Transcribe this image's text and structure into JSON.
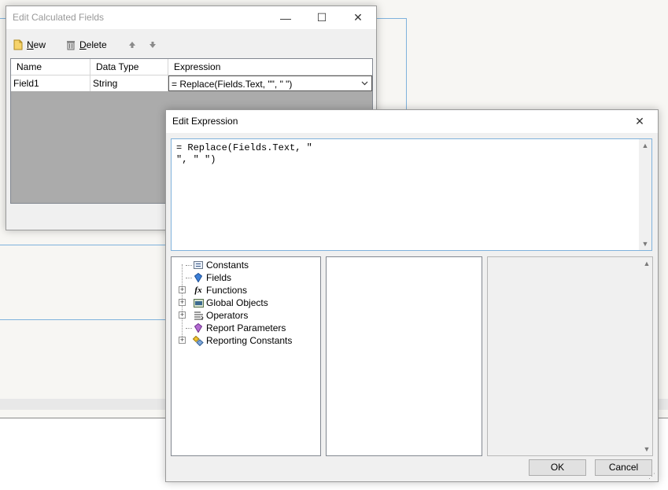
{
  "calc_window": {
    "title": "Edit Calculated Fields",
    "toolbar": {
      "new_label": "New",
      "delete_label": "Delete"
    },
    "grid": {
      "columns": [
        "Name",
        "Data Type",
        "Expression"
      ],
      "rows": [
        {
          "name": "Field1",
          "data_type": "String",
          "expression": "= Replace(Fields.Text, \"\", \" \")"
        }
      ]
    }
  },
  "expr_window": {
    "title": "Edit Expression",
    "expression_text": "= Replace(Fields.Text, \"\n\", \" \")",
    "tree": [
      {
        "label": "Constants",
        "icon": "constants-icon",
        "expandable": false
      },
      {
        "label": "Fields",
        "icon": "fields-icon",
        "expandable": false
      },
      {
        "label": "Functions",
        "icon": "function-icon",
        "expandable": true
      },
      {
        "label": "Global Objects",
        "icon": "global-objects-icon",
        "expandable": true
      },
      {
        "label": "Operators",
        "icon": "operators-icon",
        "expandable": true
      },
      {
        "label": "Report Parameters",
        "icon": "report-parameters-icon",
        "expandable": false
      },
      {
        "label": "Reporting Constants",
        "icon": "reporting-constants-icon",
        "expandable": true
      }
    ],
    "ok_label": "OK",
    "cancel_label": "Cancel"
  },
  "glyphs": {
    "minimize": "—",
    "maximize": "☐",
    "close": "✕",
    "plus": "+",
    "fx": "fx"
  },
  "colors": {
    "accent_border": "#7fb2dc",
    "grid_empty": "#ababab"
  }
}
